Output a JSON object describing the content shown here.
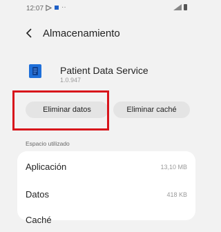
{
  "status_bar": {
    "time": "12:07"
  },
  "header": {
    "title": "Almacenamiento"
  },
  "app": {
    "name": "Patient Data Service",
    "version": "1.0.947"
  },
  "buttons": {
    "clear_data": "Eliminar datos",
    "clear_cache": "Eliminar caché"
  },
  "storage": {
    "section_label": "Espacio utilizado",
    "rows": [
      {
        "label": "Aplicación",
        "value": "13,10 MB"
      },
      {
        "label": "Datos",
        "value": "418 KB"
      },
      {
        "label": "Caché",
        "value": ""
      }
    ]
  },
  "colors": {
    "highlight": "#d8141b",
    "app_icon": "#1e6fd9",
    "background": "#f2f2f2"
  }
}
